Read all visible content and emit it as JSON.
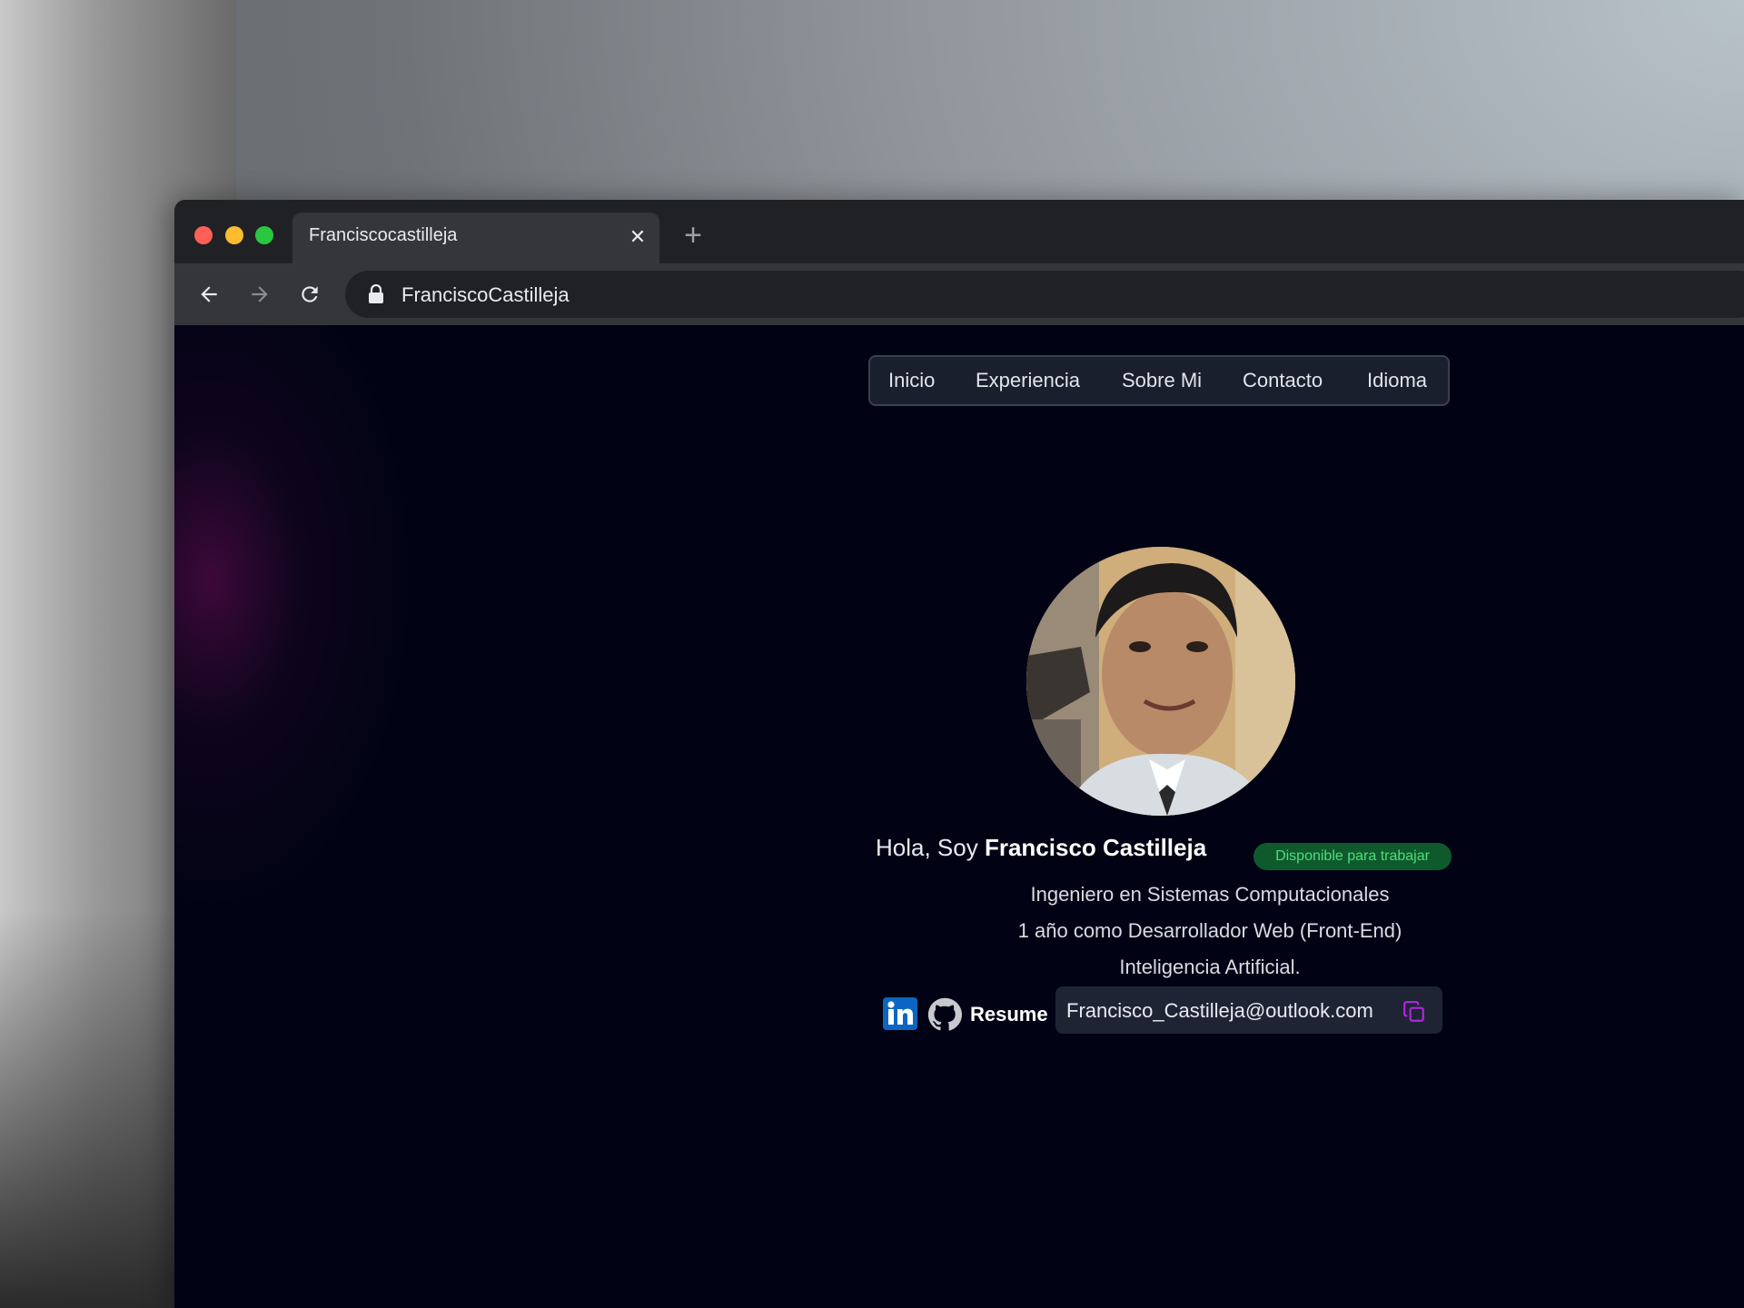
{
  "browser": {
    "tab_title": "Franciscocastilleja",
    "tab_close": "✕",
    "new_tab": "+",
    "url": "FranciscoCastilleja"
  },
  "nav": {
    "items": [
      "Inicio",
      "Experiencia",
      "Sobre Mi",
      "Contacto",
      "Idioma"
    ]
  },
  "hero": {
    "greeting": "Hola, Soy ",
    "name": "Francisco Castilleja",
    "badge": "Disponible para trabajar",
    "lines": [
      "Ingeniero en Sistemas Computacionales",
      "1 año como Desarrollador Web (Front-End)",
      "Inteligencia Artificial."
    ]
  },
  "links": {
    "resume": "Resume",
    "email": "Francisco_Castilleja@outlook.com"
  },
  "icons": [
    "back-icon",
    "forward-icon",
    "reload-icon",
    "lock-icon",
    "linkedin-icon",
    "github-icon",
    "copy-icon"
  ],
  "colors": {
    "page_bg": "#010314",
    "badge_bg": "#0f5a2c",
    "badge_text": "#4fdc7d",
    "linkedin": "#0a66c2",
    "copy_accent": "#b026e0"
  }
}
